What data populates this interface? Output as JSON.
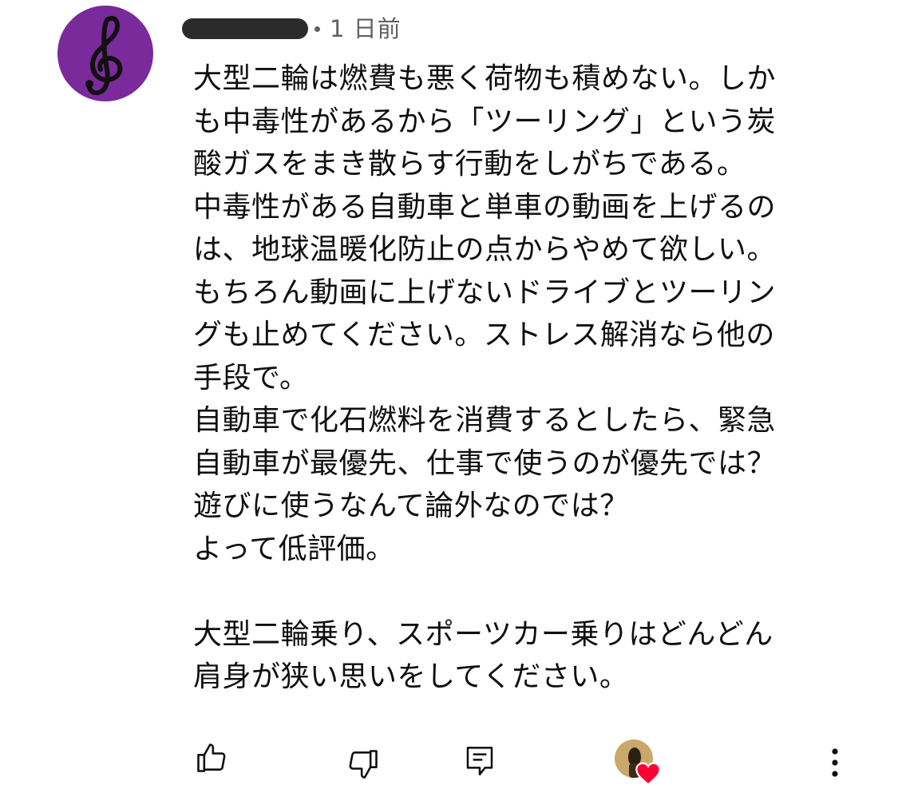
{
  "comment": {
    "author_avatar_icon": "treble-clef-avatar",
    "author_name_redacted": true,
    "timestamp": "1 日前",
    "lines": [
      "大型二輪は燃費も悪く荷物も積めない。しか",
      "も中毒性があるから「ツーリング」という炭",
      "酸ガスをまき散らす行動をしがちである。",
      "中毒性がある自動車と単車の動画を上げるの",
      "は、地球温暖化防止の点からやめて欲しい。",
      "もちろん動画に上げないドライブとツーリン",
      "グも止めてください。ストレス解消なら他の",
      "手段で。",
      "自動車で化石燃料を消費するとしたら、緊急",
      "自動車が最優先、仕事で使うのが優先では？",
      "遊びに使うなんて論外なのでは？",
      "よって低評価。",
      "",
      "大型二輪乗り、スポーツカー乗りはどんどん",
      "肩身が狭い思いをしてください。"
    ]
  },
  "actions": {
    "like_icon": "thumbs-up-icon",
    "dislike_icon": "thumbs-down-icon",
    "reply_icon": "reply-icon",
    "creator_heart_icon": "creator-heart-icon",
    "more_icon": "more-vert-icon"
  },
  "colors": {
    "avatar_bg": "#7a2a9a",
    "text": "#0f0f0f",
    "meta_text": "#606060",
    "redaction": "#2b2b2b",
    "heart": "#ff0033"
  }
}
